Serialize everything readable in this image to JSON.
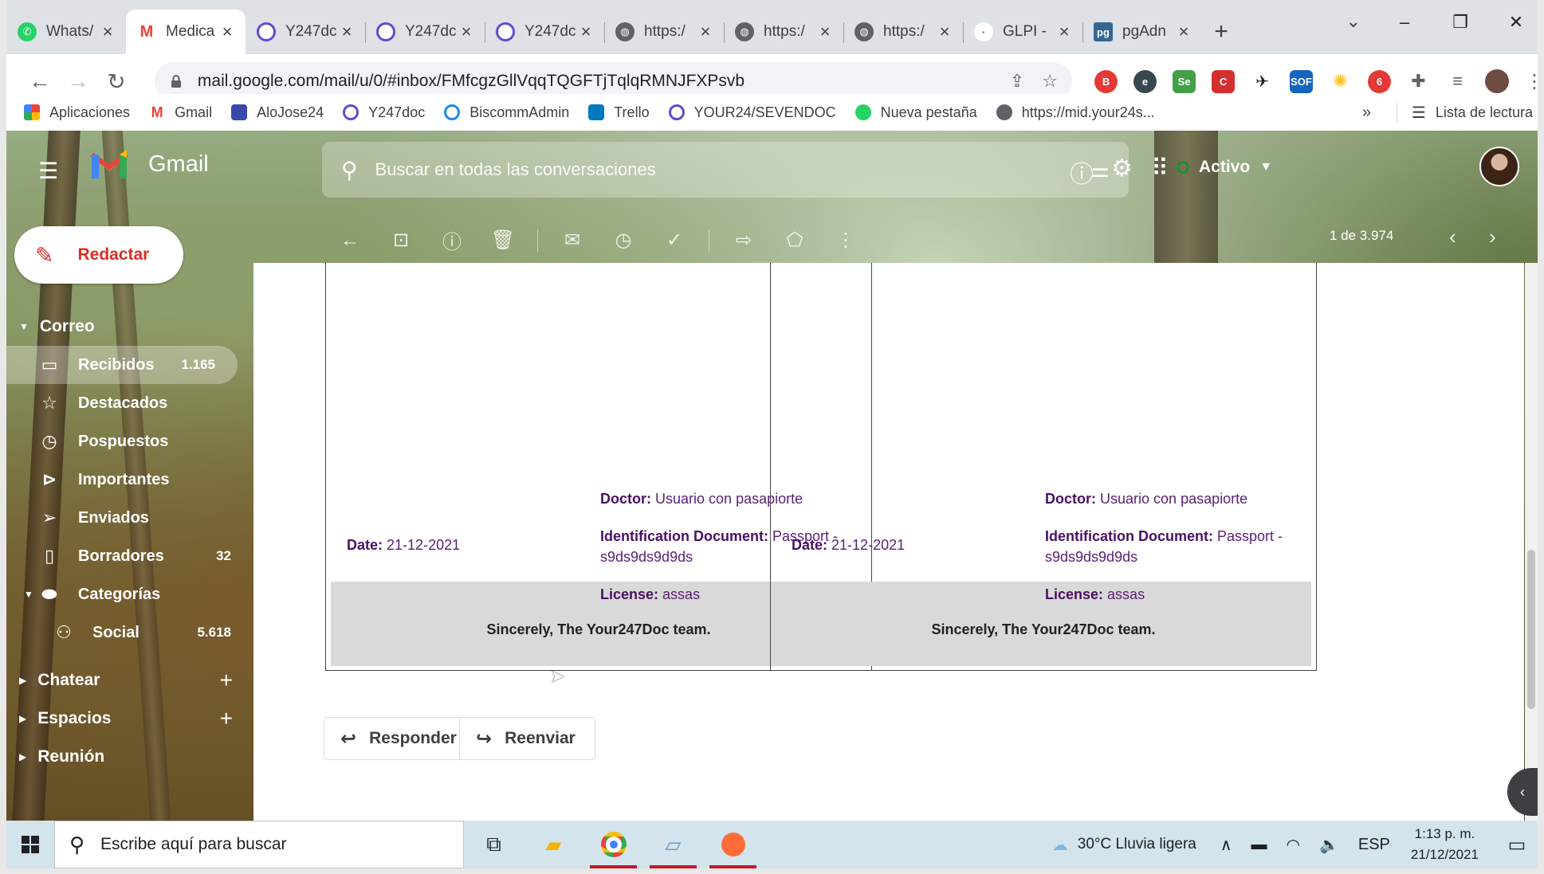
{
  "browser": {
    "tabs": [
      {
        "title": "Whats/",
        "icon": "whatsapp-icon",
        "color": "#25d366"
      },
      {
        "title": "Medica",
        "icon": "gmail-icon",
        "color": "#ea4335",
        "active": true
      },
      {
        "title": "Y247dc",
        "icon": "y247-icon",
        "color": "#5a4fcf"
      },
      {
        "title": "Y247dc",
        "icon": "y247-icon",
        "color": "#5a4fcf"
      },
      {
        "title": "Y247dc",
        "icon": "y247-icon",
        "color": "#5a4fcf"
      },
      {
        "title": "https:/",
        "icon": "globe-icon",
        "color": "#5f6368"
      },
      {
        "title": "https:/",
        "icon": "globe-icon",
        "color": "#5f6368"
      },
      {
        "title": "https:/",
        "icon": "globe-icon",
        "color": "#5f6368"
      },
      {
        "title": "GLPI -",
        "icon": "glpi-icon",
        "color": "#2d5c88"
      },
      {
        "title": "pgAdn",
        "icon": "pgadmin-icon",
        "color": "#336791"
      }
    ],
    "url": "mail.google.com/mail/u/0/#inbox/FMfcgzGllVqqTQGFTjTqlqRMNJFXPsvb",
    "bookmarks": [
      {
        "label": "Aplicaciones",
        "icon": "apps-grid-icon"
      },
      {
        "label": "Gmail",
        "icon": "gmail-icon"
      },
      {
        "label": "AloJose24",
        "icon": "bookmark-page-icon"
      },
      {
        "label": "Y247doc",
        "icon": "y247-icon"
      },
      {
        "label": "BiscommAdmin",
        "icon": "biscomm-icon"
      },
      {
        "label": "Trello",
        "icon": "trello-icon"
      },
      {
        "label": "YOUR24/SEVENDOC",
        "icon": "y247-icon"
      },
      {
        "label": "Nueva pestaña",
        "icon": "whatsapp-icon"
      },
      {
        "label": "https://mid.your24s...",
        "icon": "globe-icon"
      }
    ],
    "reading_list": "Lista de lectura",
    "more_bookmarks": "»"
  },
  "gmail": {
    "logo_text": "Gmail",
    "search_placeholder": "Buscar en todas las conversaciones",
    "status": "Activo",
    "compose_label": "Redactar",
    "pager": "1 de 3.974",
    "sections": {
      "mail": "Correo",
      "chat": "Chatear",
      "spaces": "Espacios",
      "meet": "Reunión"
    },
    "nav": [
      {
        "label": "Recibidos",
        "count": "1.165",
        "icon": "inbox-icon",
        "selected": true
      },
      {
        "label": "Destacados",
        "count": "",
        "icon": "star-icon"
      },
      {
        "label": "Pospuestos",
        "count": "",
        "icon": "clock-icon"
      },
      {
        "label": "Importantes",
        "count": "",
        "icon": "important-icon"
      },
      {
        "label": "Enviados",
        "count": "",
        "icon": "send-icon"
      },
      {
        "label": "Borradores",
        "count": "32",
        "icon": "draft-icon"
      },
      {
        "label": "Categorías",
        "count": "",
        "icon": "label-icon"
      },
      {
        "label": "Social",
        "count": "5.618",
        "icon": "people-icon"
      }
    ]
  },
  "message": {
    "cards": [
      {
        "doctor_label": "Doctor:",
        "doctor_value": "Usuario con pasapiorte",
        "date_label": "Date:",
        "date_value": "21-12-2021",
        "id_label": "Identification Document:",
        "id_value": "Passport - s9ds9ds9d9ds",
        "license_label": "License:",
        "license_value": "assas",
        "signature": "Sincerely, The Your247Doc team."
      },
      {
        "doctor_label": "Doctor:",
        "doctor_value": "Usuario con pasapiorte",
        "date_label": "Date:",
        "date_value": "21-12-2021",
        "id_label": "Identification Document:",
        "id_value": "Passport - s9ds9ds9d9ds",
        "license_label": "License:",
        "license_value": "assas",
        "signature": "Sincerely, The Your247Doc team."
      }
    ],
    "reply_label": "Responder",
    "forward_label": "Reenviar"
  },
  "taskbar": {
    "search_placeholder": "Escribe aquí para buscar",
    "weather": "30°C  Lluvia ligera",
    "language": "ESP",
    "time": "1:13 p. m.",
    "date": "21/12/2021"
  },
  "colors": {
    "gmail_red": "#d93025",
    "chrome_tabstrip": "#dee1e6",
    "taskbar": "#d3e4ec",
    "card_grey": "#d9d9d9",
    "card_text": "#5b1e78"
  }
}
